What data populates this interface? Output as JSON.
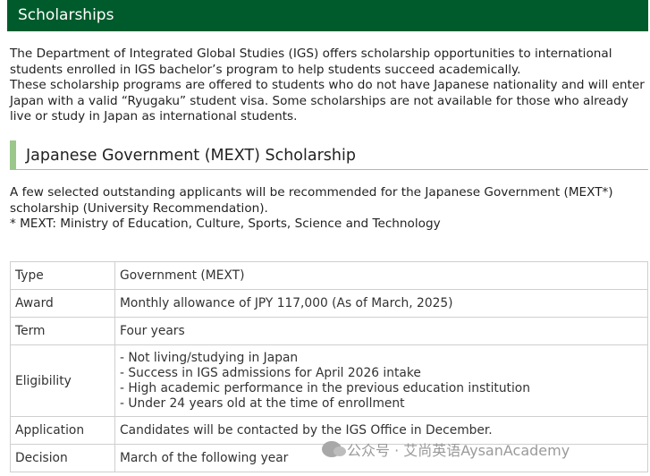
{
  "header": {
    "title": "Scholarships"
  },
  "intro": {
    "p1": "The Department of Integrated Global Studies (IGS) offers scholarship opportunities to international students enrolled in IGS bachelor’s program to help students succeed academically.",
    "p2": "These scholarship programs are offered to students who do not have Japanese nationality and will enter Japan with a valid “Ryugaku” student visa. Some scholarships are not available for those who already live or study in Japan as international students."
  },
  "section": {
    "title": "Japanese Government (MEXT) Scholarship",
    "desc1": "A few selected outstanding applicants will be recommended for the Japanese Government (MEXT*) scholarship (University Recommendation).",
    "desc2": "* MEXT: Ministry of Education, Culture, Sports, Science and Technology"
  },
  "table": {
    "type_k": "Type",
    "type_v": "Government (MEXT)",
    "award_k": "Award",
    "award_v": "Monthly allowance of JPY 117,000 (As of March, 2025)",
    "term_k": "Term",
    "term_v": "Four years",
    "elig_k": "Eligibility",
    "elig_1": "- Not living/studying in Japan",
    "elig_2": "- Success in IGS admissions for April 2026 intake",
    "elig_3": "- High academic performance in the previous education institution",
    "elig_4": "- Under 24 years old at the time of enrollment",
    "app_k": "Application",
    "app_v": "Candidates will be contacted by the IGS Office in December.",
    "dec_k": "Decision",
    "dec_v": "March of the following year"
  },
  "watermark": {
    "text": "公众号 · 艾尚英语AysanAcademy",
    "icon": "wechat-icon"
  }
}
